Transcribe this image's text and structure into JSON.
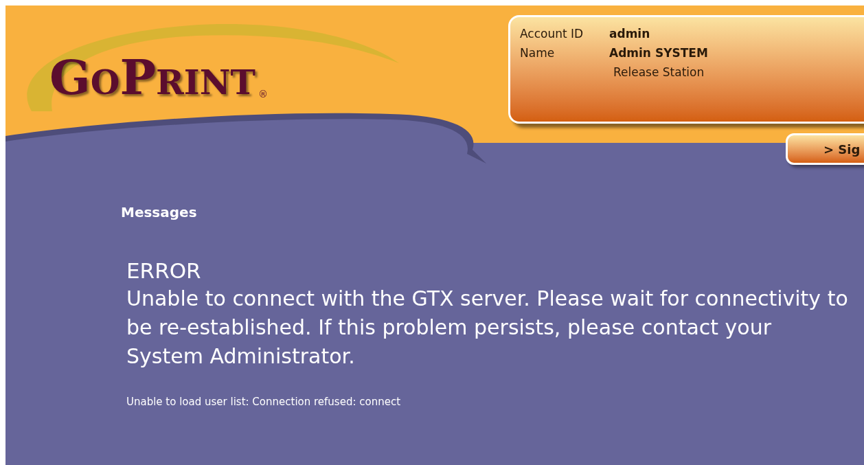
{
  "logo": {
    "text": "GoPrint",
    "mark": "®"
  },
  "account": {
    "id_label": "Account ID",
    "id_value": "admin",
    "name_label": "Name",
    "name_value": "Admin SYSTEM",
    "station": "Release Station"
  },
  "sign_button": {
    "label": "> Sig"
  },
  "messages": {
    "heading": "Messages",
    "error_title": "ERROR",
    "error_text": "Unable to connect with the GTX server. Please wait for connectivity to be re-established. If this problem persists, please contact your System Administrator.",
    "detail": "Unable to load user list: Connection refused: connect"
  }
}
